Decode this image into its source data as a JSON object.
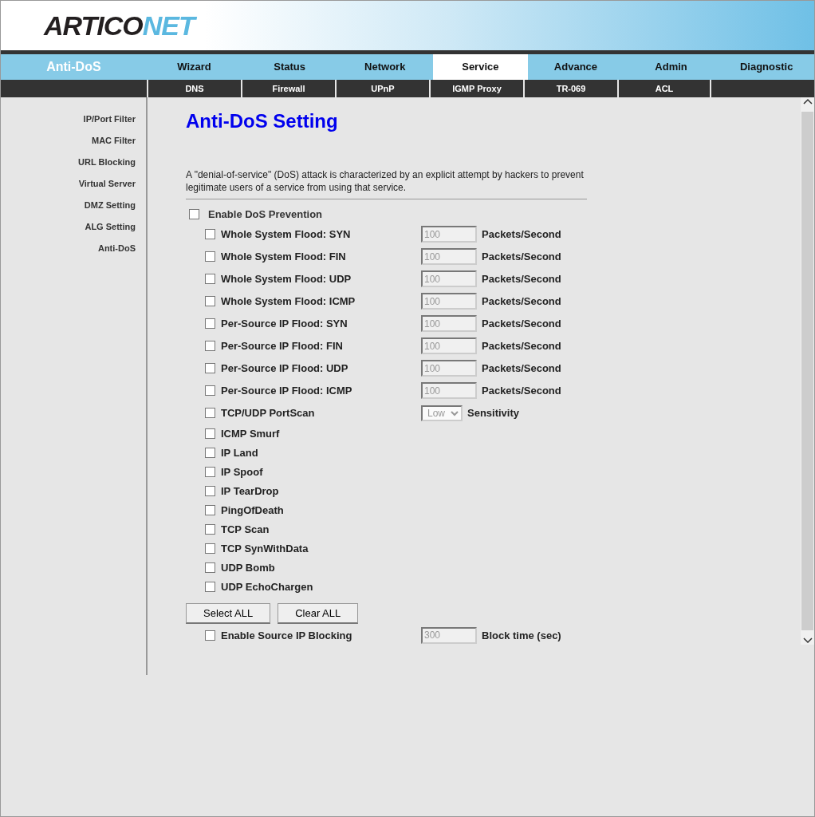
{
  "logo": {
    "parts": [
      {
        "text": "ARTICO",
        "accent": false
      },
      {
        "text": "NET",
        "accent": true
      }
    ]
  },
  "section_label": "Anti-DoS",
  "tabs": [
    {
      "label": "Wizard",
      "selected": false
    },
    {
      "label": "Status",
      "selected": false
    },
    {
      "label": "Network",
      "selected": false
    },
    {
      "label": "Service",
      "selected": true
    },
    {
      "label": "Advance",
      "selected": false
    },
    {
      "label": "Admin",
      "selected": false
    },
    {
      "label": "Diagnostic",
      "selected": false
    }
  ],
  "subtabs": [
    "DNS",
    "Firewall",
    "UPnP",
    "IGMP Proxy",
    "TR-069",
    "ACL"
  ],
  "sidebar": {
    "items": [
      "IP/Port Filter",
      "MAC Filter",
      "URL Blocking",
      "Virtual Server",
      "DMZ Setting",
      "ALG Setting",
      "Anti-DoS"
    ]
  },
  "title": "Anti-DoS Setting",
  "description": "A \"denial-of-service\" (DoS) attack is characterized by an explicit attempt by hackers to prevent legitimate users of a service from using that service.",
  "enable": {
    "label": "Enable DoS Prevention",
    "checked": false
  },
  "options": [
    {
      "kind": "rate",
      "label": "Whole System Flood: SYN",
      "checked": false,
      "value": "100",
      "disabled": true,
      "unit": "Packets/Second"
    },
    {
      "kind": "rate",
      "label": "Whole System Flood: FIN",
      "checked": false,
      "value": "100",
      "disabled": true,
      "unit": "Packets/Second"
    },
    {
      "kind": "rate",
      "label": "Whole System Flood: UDP",
      "checked": false,
      "value": "100",
      "disabled": true,
      "unit": "Packets/Second"
    },
    {
      "kind": "rate",
      "label": "Whole System Flood: ICMP",
      "checked": false,
      "value": "100",
      "disabled": true,
      "unit": "Packets/Second"
    },
    {
      "kind": "rate",
      "label": "Per-Source IP Flood: SYN",
      "checked": false,
      "value": "100",
      "disabled": true,
      "unit": "Packets/Second"
    },
    {
      "kind": "rate",
      "label": "Per-Source IP Flood: FIN",
      "checked": false,
      "value": "100",
      "disabled": true,
      "unit": "Packets/Second"
    },
    {
      "kind": "rate",
      "label": "Per-Source IP Flood: UDP",
      "checked": false,
      "value": "100",
      "disabled": true,
      "unit": "Packets/Second"
    },
    {
      "kind": "rate",
      "label": "Per-Source IP Flood: ICMP",
      "checked": false,
      "value": "100",
      "disabled": true,
      "unit": "Packets/Second"
    },
    {
      "kind": "select",
      "label": "TCP/UDP PortScan",
      "checked": false,
      "value": "Low",
      "disabled": true,
      "unit": "Sensitivity"
    },
    {
      "kind": "plain",
      "label": "ICMP Smurf",
      "checked": false
    },
    {
      "kind": "plain",
      "label": "IP Land",
      "checked": false
    },
    {
      "kind": "plain",
      "label": "IP Spoof",
      "checked": false
    },
    {
      "kind": "plain",
      "label": "IP TearDrop",
      "checked": false
    },
    {
      "kind": "plain",
      "label": "PingOfDeath",
      "checked": false
    },
    {
      "kind": "plain",
      "label": "TCP Scan",
      "checked": false
    },
    {
      "kind": "plain",
      "label": "TCP SynWithData",
      "checked": false
    },
    {
      "kind": "plain",
      "label": "UDP Bomb",
      "checked": false
    },
    {
      "kind": "plain",
      "label": "UDP EchoChargen",
      "checked": false
    }
  ],
  "buttons": [
    "Select ALL",
    "Clear ALL"
  ],
  "source_blocking": {
    "label": "Enable Source IP Blocking",
    "checked": false,
    "value": "300",
    "disabled": true,
    "unit": "Block time (sec)"
  }
}
